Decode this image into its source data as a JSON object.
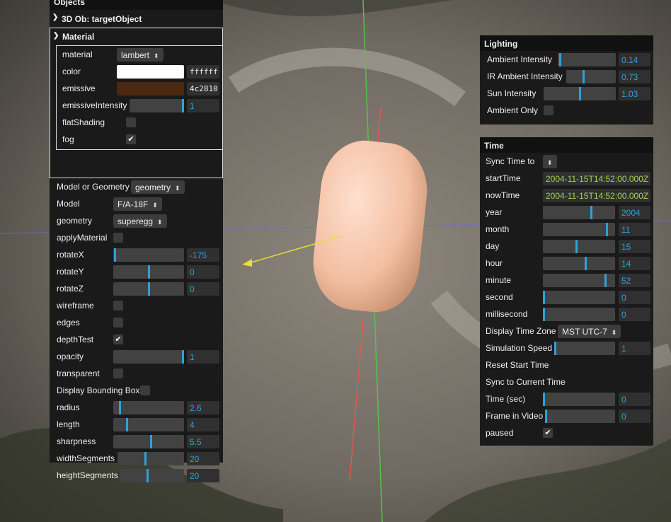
{
  "objects": {
    "title": "Objects",
    "folder_title": "3D Ob: targetObject",
    "material_folder": "Material",
    "material": [
      {
        "label": "material",
        "type": "select",
        "value": "lambert"
      },
      {
        "label": "color",
        "type": "color",
        "value": "ffffff",
        "swatch": "#ffffff"
      },
      {
        "label": "emissive",
        "type": "color",
        "value": "4c2810",
        "swatch": "#4c2810"
      },
      {
        "label": "emissiveIntensity",
        "type": "slider",
        "value": "1",
        "level": 1.0
      },
      {
        "label": "flatShading",
        "type": "checkbox",
        "checked": false
      },
      {
        "label": "fog",
        "type": "checkbox",
        "checked": true
      }
    ],
    "controls": [
      {
        "label": "Model or Geometry",
        "type": "select",
        "value": "geometry"
      },
      {
        "label": "Model",
        "type": "select",
        "value": "F/A-18F"
      },
      {
        "label": "geometry",
        "type": "select",
        "value": "superegg"
      },
      {
        "label": "applyMaterial",
        "type": "checkbox",
        "checked": false
      },
      {
        "label": "rotateX",
        "type": "slider",
        "value": "-175",
        "level": 0.01
      },
      {
        "label": "rotateY",
        "type": "slider",
        "value": "0",
        "level": 0.5
      },
      {
        "label": "rotateZ",
        "type": "slider",
        "value": "0",
        "level": 0.5
      },
      {
        "label": "wireframe",
        "type": "checkbox",
        "checked": false
      },
      {
        "label": "edges",
        "type": "checkbox",
        "checked": false
      },
      {
        "label": "depthTest",
        "type": "checkbox",
        "checked": true
      },
      {
        "label": "opacity",
        "type": "slider",
        "value": "1",
        "level": 1.0
      },
      {
        "label": "transparent",
        "type": "checkbox",
        "checked": false
      },
      {
        "label": "Display Bounding Box",
        "type": "checkbox",
        "checked": false
      },
      {
        "label": "radius",
        "type": "slider",
        "value": "2.6",
        "level": 0.08
      },
      {
        "label": "length",
        "type": "slider",
        "value": "4",
        "level": 0.19
      },
      {
        "label": "sharpness",
        "type": "slider",
        "value": "5.5",
        "level": 0.54
      },
      {
        "label": "widthSegments",
        "type": "slider",
        "value": "20",
        "level": 0.42
      },
      {
        "label": "heightSegments",
        "type": "slider",
        "value": "20",
        "level": 0.42
      }
    ]
  },
  "lighting": {
    "title": "Lighting",
    "rows": [
      {
        "label": "Ambient Intensity",
        "type": "slider",
        "value": "0.14",
        "level": 0.02
      },
      {
        "label": "IR Ambient Intensity",
        "type": "slider",
        "value": "0.73",
        "level": 0.35
      },
      {
        "label": "Sun Intensity",
        "type": "slider",
        "value": "1.03",
        "level": 0.5
      },
      {
        "label": "Ambient Only",
        "type": "checkbox",
        "checked": false
      }
    ]
  },
  "time": {
    "title": "Time",
    "rows": [
      {
        "label": "Sync Time to",
        "type": "select",
        "value": ""
      },
      {
        "label": "startTime",
        "type": "text",
        "value": "2004-11-15T14:52:00.000Z"
      },
      {
        "label": "nowTime",
        "type": "text",
        "value": "2004-11-15T14:52:00.000Z"
      },
      {
        "label": "year",
        "type": "slider",
        "value": "2004",
        "level": 0.68
      },
      {
        "label": "month",
        "type": "slider",
        "value": "11",
        "level": 0.9
      },
      {
        "label": "day",
        "type": "slider",
        "value": "15",
        "level": 0.46
      },
      {
        "label": "hour",
        "type": "slider",
        "value": "14",
        "level": 0.6
      },
      {
        "label": "minute",
        "type": "slider",
        "value": "52",
        "level": 0.88
      },
      {
        "label": "second",
        "type": "slider",
        "value": "0",
        "level": 0.0
      },
      {
        "label": "millisecond",
        "type": "slider",
        "value": "0",
        "level": 0.0
      },
      {
        "label": "Display Time Zone",
        "type": "select",
        "value": "MST UTC-7"
      },
      {
        "label": "Simulation Speed",
        "type": "slider",
        "value": "1",
        "level": 0.0
      },
      {
        "label": "Reset Start Time",
        "type": "button"
      },
      {
        "label": "Sync to Current Time",
        "type": "button"
      },
      {
        "label": "Time (sec)",
        "type": "slider",
        "value": "0",
        "level": 0.0
      },
      {
        "label": "Frame in Video",
        "type": "slider",
        "value": "0",
        "level": 0.0
      },
      {
        "label": "paused",
        "type": "checkbox",
        "checked": true
      }
    ]
  },
  "colors": {
    "accent": "#2fa1d6",
    "panel_bg": "#1a1a1a",
    "text_value_green": "#a8d35a",
    "object_color": "#f4c2a8"
  },
  "icons": [
    "chevron-down-icon",
    "checkmark-icon",
    "select-arrows-icon"
  ]
}
